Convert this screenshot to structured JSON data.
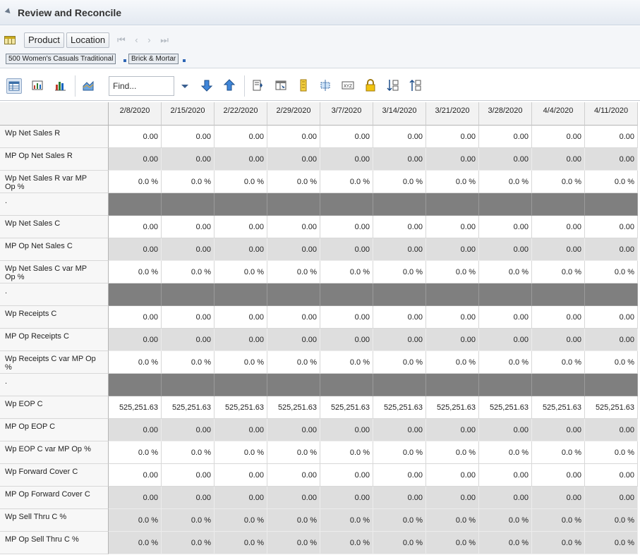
{
  "header": {
    "title": "Review and Reconcile"
  },
  "dimensions": {
    "buttons": [
      "Product",
      "Location"
    ],
    "nav_arrows": "⏮ ‹ › ⏭",
    "chips": [
      "500 Women's Casuals Traditional",
      "Brick & Mortar"
    ]
  },
  "toolbar": {
    "find_placeholder": "Find...",
    "icons": [
      "grid-view-icon",
      "chart-grid-icon",
      "bar-chart-icon",
      "area-chart-icon",
      "move-down-icon",
      "move-up-icon",
      "export-icon",
      "show-hide-icon",
      "highlight-icon",
      "split-icon",
      "xyz-icon",
      "lock-icon",
      "sort-ascending-icon",
      "sort-descending-icon"
    ]
  },
  "grid": {
    "columns": [
      "2/8/2020",
      "2/15/2020",
      "2/22/2020",
      "2/29/2020",
      "3/7/2020",
      "3/14/2020",
      "3/21/2020",
      "3/28/2020",
      "4/4/2020",
      "4/11/2020"
    ],
    "rows": [
      {
        "label": "Wp Net Sales R",
        "style": "white",
        "values": [
          "0.00",
          "0.00",
          "0.00",
          "0.00",
          "0.00",
          "0.00",
          "0.00",
          "0.00",
          "0.00",
          "0.00"
        ]
      },
      {
        "label": "MP Op Net Sales R",
        "style": "gray",
        "values": [
          "0.00",
          "0.00",
          "0.00",
          "0.00",
          "0.00",
          "0.00",
          "0.00",
          "0.00",
          "0.00",
          "0.00"
        ]
      },
      {
        "label": "Wp Net Sales R var MP Op %",
        "style": "white",
        "values": [
          "0.0 %",
          "0.0 %",
          "0.0 %",
          "0.0 %",
          "0.0 %",
          "0.0 %",
          "0.0 %",
          "0.0 %",
          "0.0 %",
          "0.0 %"
        ]
      },
      {
        "label": ".",
        "style": "sep",
        "values": [
          "",
          "",
          "",
          "",
          "",
          "",
          "",
          "",
          "",
          ""
        ]
      },
      {
        "label": "Wp Net Sales C",
        "style": "white",
        "values": [
          "0.00",
          "0.00",
          "0.00",
          "0.00",
          "0.00",
          "0.00",
          "0.00",
          "0.00",
          "0.00",
          "0.00"
        ]
      },
      {
        "label": "MP Op Net Sales C",
        "style": "gray",
        "values": [
          "0.00",
          "0.00",
          "0.00",
          "0.00",
          "0.00",
          "0.00",
          "0.00",
          "0.00",
          "0.00",
          "0.00"
        ]
      },
      {
        "label": "Wp Net Sales C var MP Op %",
        "style": "white",
        "values": [
          "0.0 %",
          "0.0 %",
          "0.0 %",
          "0.0 %",
          "0.0 %",
          "0.0 %",
          "0.0 %",
          "0.0 %",
          "0.0 %",
          "0.0 %"
        ]
      },
      {
        "label": ".",
        "style": "sep",
        "values": [
          "",
          "",
          "",
          "",
          "",
          "",
          "",
          "",
          "",
          ""
        ]
      },
      {
        "label": "Wp Receipts C",
        "style": "white",
        "values": [
          "0.00",
          "0.00",
          "0.00",
          "0.00",
          "0.00",
          "0.00",
          "0.00",
          "0.00",
          "0.00",
          "0.00"
        ]
      },
      {
        "label": "MP Op Receipts C",
        "style": "gray",
        "values": [
          "0.00",
          "0.00",
          "0.00",
          "0.00",
          "0.00",
          "0.00",
          "0.00",
          "0.00",
          "0.00",
          "0.00"
        ]
      },
      {
        "label": "Wp Receipts C var MP Op %",
        "style": "white",
        "values": [
          "0.0 %",
          "0.0 %",
          "0.0 %",
          "0.0 %",
          "0.0 %",
          "0.0 %",
          "0.0 %",
          "0.0 %",
          "0.0 %",
          "0.0 %"
        ]
      },
      {
        "label": ".",
        "style": "sep",
        "values": [
          "",
          "",
          "",
          "",
          "",
          "",
          "",
          "",
          "",
          ""
        ]
      },
      {
        "label": "Wp EOP C",
        "style": "white",
        "values": [
          "525,251.63",
          "525,251.63",
          "525,251.63",
          "525,251.63",
          "525,251.63",
          "525,251.63",
          "525,251.63",
          "525,251.63",
          "525,251.63",
          "525,251.63"
        ]
      },
      {
        "label": "MP Op EOP C",
        "style": "gray",
        "values": [
          "0.00",
          "0.00",
          "0.00",
          "0.00",
          "0.00",
          "0.00",
          "0.00",
          "0.00",
          "0.00",
          "0.00"
        ]
      },
      {
        "label": "Wp EOP C var MP Op %",
        "style": "white",
        "values": [
          "0.0 %",
          "0.0 %",
          "0.0 %",
          "0.0 %",
          "0.0 %",
          "0.0 %",
          "0.0 %",
          "0.0 %",
          "0.0 %",
          "0.0 %"
        ]
      },
      {
        "label": "Wp Forward Cover C",
        "style": "white",
        "values": [
          "0.00",
          "0.00",
          "0.00",
          "0.00",
          "0.00",
          "0.00",
          "0.00",
          "0.00",
          "0.00",
          "0.00"
        ]
      },
      {
        "label": "MP Op Forward Cover C",
        "style": "gray",
        "values": [
          "0.00",
          "0.00",
          "0.00",
          "0.00",
          "0.00",
          "0.00",
          "0.00",
          "0.00",
          "0.00",
          "0.00"
        ]
      },
      {
        "label": "Wp Sell Thru C %",
        "style": "gray",
        "values": [
          "0.0 %",
          "0.0 %",
          "0.0 %",
          "0.0 %",
          "0.0 %",
          "0.0 %",
          "0.0 %",
          "0.0 %",
          "0.0 %",
          "0.0 %"
        ]
      },
      {
        "label": "MP Op Sell Thru C %",
        "style": "gray",
        "values": [
          "0.0 %",
          "0.0 %",
          "0.0 %",
          "0.0 %",
          "0.0 %",
          "0.0 %",
          "0.0 %",
          "0.0 %",
          "0.0 %",
          "0.0 %"
        ]
      }
    ]
  }
}
